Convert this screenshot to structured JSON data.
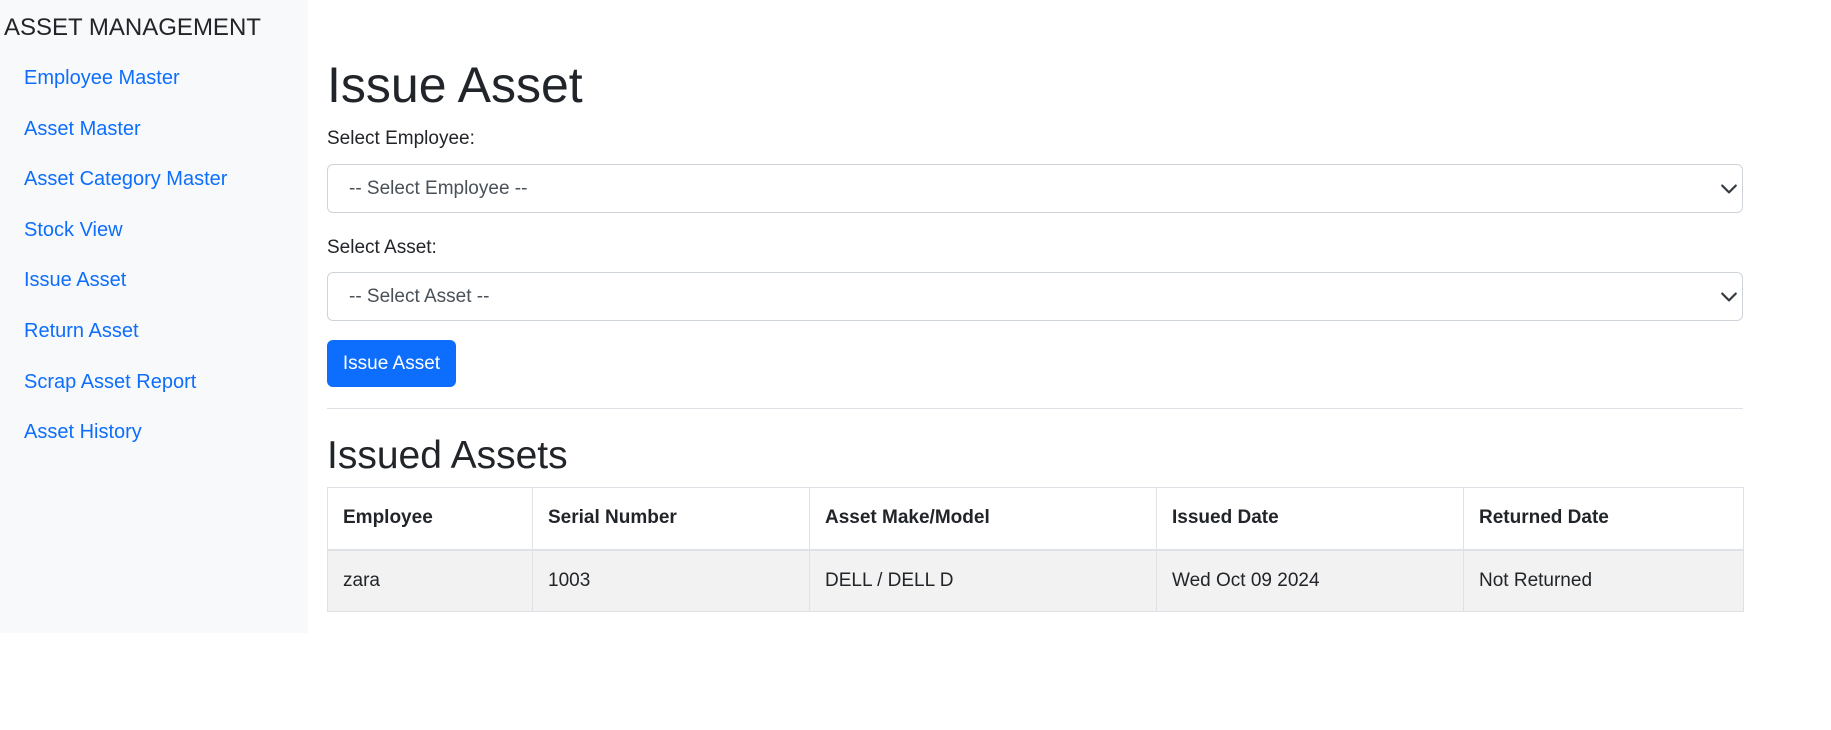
{
  "sidebar": {
    "brand": "ASSET MANAGEMENT",
    "items": [
      {
        "label": "Employee Master"
      },
      {
        "label": "Asset Master"
      },
      {
        "label": "Asset Category Master"
      },
      {
        "label": "Stock View"
      },
      {
        "label": "Issue Asset"
      },
      {
        "label": "Return Asset"
      },
      {
        "label": "Scrap Asset Report"
      },
      {
        "label": "Asset History"
      }
    ]
  },
  "main": {
    "title": "Issue Asset",
    "employee": {
      "label": "Select Employee:",
      "selected": "-- Select Employee --"
    },
    "asset": {
      "label": "Select Asset:",
      "selected": "-- Select Asset --"
    },
    "issue_button": "Issue Asset",
    "issued_section_title": "Issued Assets",
    "table": {
      "columns": [
        "Employee",
        "Serial Number",
        "Asset Make/Model",
        "Issued Date",
        "Returned Date"
      ],
      "rows": [
        [
          "zara",
          "1003",
          "DELL / DELL D",
          "Wed Oct 09 2024",
          "Not Returned"
        ]
      ]
    }
  },
  "colors": {
    "link": "#0d6efd",
    "primary_button": "#0d6efd",
    "sidebar_bg": "#f8f9fa",
    "row_bg": "#f2f2f2"
  },
  "icons": {
    "select_arrow": "chevron-down-icon"
  }
}
